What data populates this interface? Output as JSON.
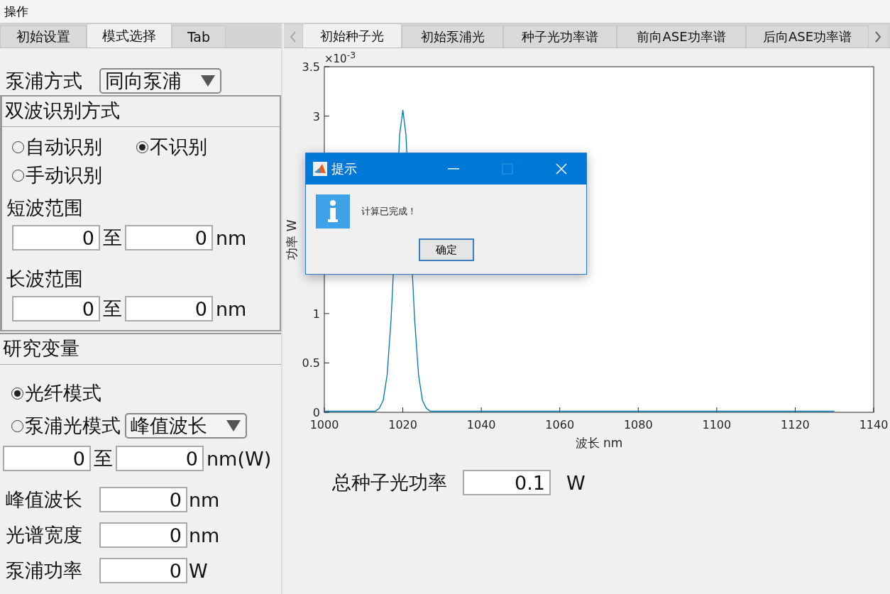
{
  "menu": [
    "操作"
  ],
  "left_tabs": [
    {
      "label": "初始设置",
      "selected": false
    },
    {
      "label": "模式选择",
      "selected": true
    },
    {
      "label": "Tab",
      "selected": false
    }
  ],
  "pump_mode": {
    "label": "泵浦方式",
    "value": "同向泵浦"
  },
  "dual_wave": {
    "title": "双波识别方式",
    "options": [
      {
        "label": "自动识别",
        "selected": false
      },
      {
        "label": "不识别",
        "selected": true
      },
      {
        "label": "手动识别",
        "selected": false
      }
    ],
    "ranges": [
      {
        "label": "短波范围",
        "from": "0",
        "to_word": "至",
        "to": "0",
        "unit": "nm"
      },
      {
        "label": "长波范围",
        "from": "0",
        "to_word": "至",
        "to": "0",
        "unit": "nm"
      }
    ]
  },
  "study_variable": {
    "title": "研究变量",
    "options": [
      {
        "label": "光纤模式",
        "selected": true
      },
      {
        "label": "泵浦光模式",
        "selected": false
      }
    ],
    "select_value": "峰值波长",
    "range": {
      "from": "0",
      "to_word": "至",
      "to": "0",
      "unit": "nm(W)"
    },
    "params": [
      {
        "label": "峰值波长",
        "value": "0",
        "unit": "nm"
      },
      {
        "label": "光谱宽度",
        "value": "0",
        "unit": "nm"
      },
      {
        "label": "泵浦功率",
        "value": "0",
        "unit": "W"
      }
    ]
  },
  "right_tabs": [
    {
      "label": "初始种子光",
      "selected": true
    },
    {
      "label": "初始泵浦光",
      "selected": false
    },
    {
      "label": "种子光功率谱",
      "selected": false
    },
    {
      "label": "前向ASE功率谱",
      "selected": false
    },
    {
      "label": "后向ASE功率谱",
      "selected": false
    }
  ],
  "chart": {
    "exponent": "×10$^{-3}$",
    "chart_data": {
      "type": "line",
      "xlabel": "波长 nm",
      "ylabel": "功率 W",
      "x": [
        1000,
        1013,
        1014,
        1015,
        1016,
        1017,
        1017.5,
        1019.2,
        1020,
        1020.8,
        1022.5,
        1023,
        1024,
        1025,
        1026,
        1027,
        1130
      ],
      "series": [
        {
          "color": "#0072bd",
          "values": [
            0,
            0,
            0.03,
            0.11,
            0.37,
            0.93,
            1.34,
            2.8,
            3.05,
            2.8,
            1.34,
            0.93,
            0.37,
            0.11,
            0.03,
            0,
            0
          ]
        }
      ],
      "xlim": [
        1000,
        1140
      ],
      "ylim": [
        0,
        3.5
      ],
      "xticks": [
        1000,
        1020,
        1040,
        1060,
        1080,
        1100,
        1120,
        1140
      ],
      "yticks": [
        0,
        0.5,
        1,
        3,
        3.5
      ]
    }
  },
  "total": {
    "label": "总种子光功率",
    "value": "0.1",
    "unit": "W"
  },
  "dialog": {
    "title": "提示",
    "message": "计算已完成！",
    "button": "确定"
  }
}
